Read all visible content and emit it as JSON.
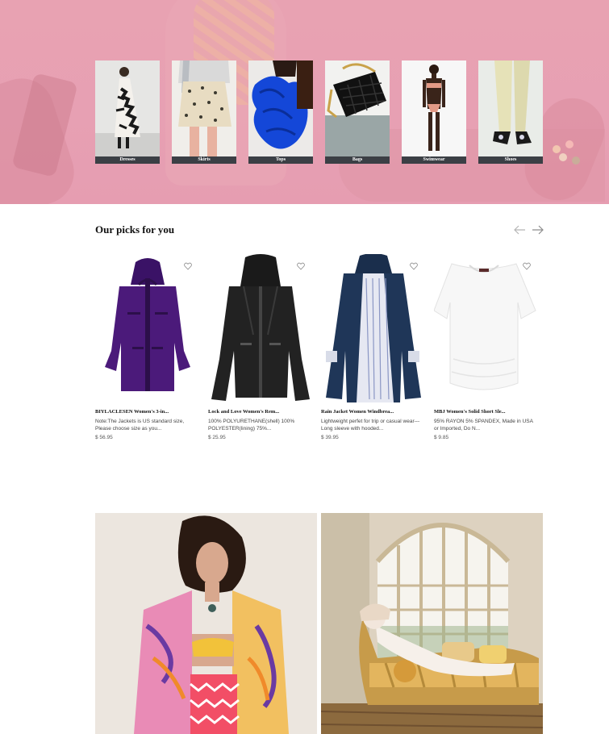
{
  "hero": {
    "background_color": "#e8a2b2"
  },
  "categories": [
    {
      "label": "Dresses"
    },
    {
      "label": "Skirts"
    },
    {
      "label": "Tops"
    },
    {
      "label": "Bags"
    },
    {
      "label": "Swimwear"
    },
    {
      "label": "Shoes"
    }
  ],
  "picks": {
    "title": "Our picks for you",
    "prev_icon": "arrow-left-icon",
    "next_icon": "arrow-right-icon",
    "products": [
      {
        "name": "BIYLACLESEN Women's 3-in...",
        "desc": "Note:The Jackets is US standard size, Please choose size as you...",
        "price": "$ 56.95",
        "color": "#4b1a7a"
      },
      {
        "name": "Lock and Love Women's Rem...",
        "desc": "100% POLYURETHANE(shell) 100% POLYESTER(lining) 75%...",
        "price": "$ 25.95",
        "color": "#1e1e1e"
      },
      {
        "name": "Rain Jacket Women Windbrea...",
        "desc": "Lightweight perfet for trip or casual wear---Long sleeve with hooded...",
        "price": "$ 39.95",
        "color": "#1f3658"
      },
      {
        "name": "MBJ Women's Solid Short Sle...",
        "desc": "95% RAYON 5% SPANDEX, Made in USA or Imported, Do N...",
        "price": "$ 9.85",
        "color": "#f5f5f5"
      }
    ]
  }
}
